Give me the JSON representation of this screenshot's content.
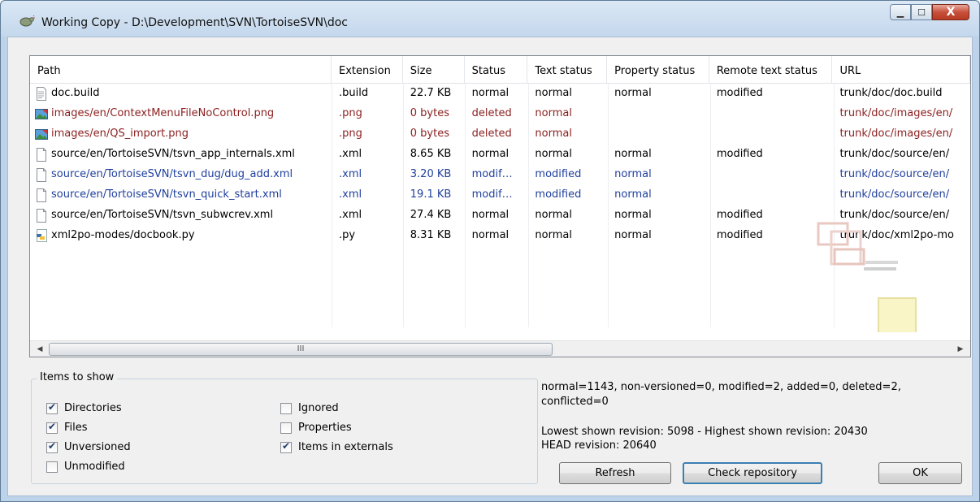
{
  "window": {
    "title": "Working Copy - D:\\Development\\SVN\\TortoiseSVN\\doc",
    "icon": "tortoise-svn-icon",
    "controls": [
      "minimize-icon",
      "maximize-icon",
      "close-icon"
    ],
    "control_glyphs": {
      "minimize": "▁",
      "maximize": "☐",
      "close": "X"
    }
  },
  "list": {
    "columns": [
      "Path",
      "Extension",
      "Size",
      "Status",
      "Text status",
      "Property status",
      "Remote text status",
      "URL"
    ],
    "rows": [
      {
        "icon": "text-file-icon",
        "state": "normal",
        "path": "doc.build",
        "ext": ".build",
        "size": "22.7 KB",
        "status": "normal",
        "text_status": "normal",
        "prop_status": "normal",
        "remote_text_status": "modified",
        "url": "trunk/doc/doc.build"
      },
      {
        "icon": "image-file-icon",
        "state": "deleted",
        "path": "images/en/ContextMenuFileNoControl.png",
        "ext": ".png",
        "size": "0 bytes",
        "status": "deleted",
        "text_status": "normal",
        "prop_status": "",
        "remote_text_status": "",
        "url": "trunk/doc/images/en/"
      },
      {
        "icon": "image-file-icon",
        "state": "deleted",
        "path": "images/en/QS_import.png",
        "ext": ".png",
        "size": "0 bytes",
        "status": "deleted",
        "text_status": "normal",
        "prop_status": "",
        "remote_text_status": "",
        "url": "trunk/doc/images/en/"
      },
      {
        "icon": "blank-file-icon",
        "state": "normal",
        "path": "source/en/TortoiseSVN/tsvn_app_internals.xml",
        "ext": ".xml",
        "size": "8.65 KB",
        "status": "normal",
        "text_status": "normal",
        "prop_status": "normal",
        "remote_text_status": "modified",
        "url": "trunk/doc/source/en/"
      },
      {
        "icon": "blank-file-icon",
        "state": "modified",
        "path": "source/en/TortoiseSVN/tsvn_dug/dug_add.xml",
        "ext": ".xml",
        "size": "3.20 KB",
        "status": "modif…",
        "text_status": "modified",
        "prop_status": "normal",
        "remote_text_status": "",
        "url": "trunk/doc/source/en/"
      },
      {
        "icon": "blank-file-icon",
        "state": "modified",
        "path": "source/en/TortoiseSVN/tsvn_quick_start.xml",
        "ext": ".xml",
        "size": "19.1 KB",
        "status": "modif…",
        "text_status": "modified",
        "prop_status": "normal",
        "remote_text_status": "",
        "url": "trunk/doc/source/en/"
      },
      {
        "icon": "blank-file-icon",
        "state": "normal",
        "path": "source/en/TortoiseSVN/tsvn_subwcrev.xml",
        "ext": ".xml",
        "size": "27.4 KB",
        "status": "normal",
        "text_status": "normal",
        "prop_status": "normal",
        "remote_text_status": "modified",
        "url": "trunk/doc/source/en/"
      },
      {
        "icon": "python-file-icon",
        "state": "normal",
        "path": "xml2po-modes/docbook.py",
        "ext": ".py",
        "size": "8.31 KB",
        "status": "normal",
        "text_status": "normal",
        "prop_status": "normal",
        "remote_text_status": "modified",
        "url": "trunk/doc/xml2po-mo"
      }
    ],
    "scroll_thumb_label": "III",
    "scroll_left": "◀",
    "scroll_right": "▶"
  },
  "items_to_show": {
    "title": "Items to show",
    "left": [
      {
        "label": "Directories",
        "checked": true
      },
      {
        "label": "Files",
        "checked": true
      },
      {
        "label": "Unversioned",
        "checked": true
      },
      {
        "label": "Unmodified",
        "checked": false
      }
    ],
    "right": [
      {
        "label": "Ignored",
        "checked": false
      },
      {
        "label": "Properties",
        "checked": false
      },
      {
        "label": "Items in externals",
        "checked": true
      }
    ]
  },
  "summary": {
    "counts": "normal=1143, non-versioned=0, modified=2, added=0, deleted=2, conflicted=0",
    "revision_range": "Lowest shown revision: 5098 - Highest shown revision: 20430",
    "head_revision": "HEAD revision: 20640"
  },
  "buttons": {
    "refresh": "Refresh",
    "check_repository": "Check repository",
    "ok": "OK"
  }
}
